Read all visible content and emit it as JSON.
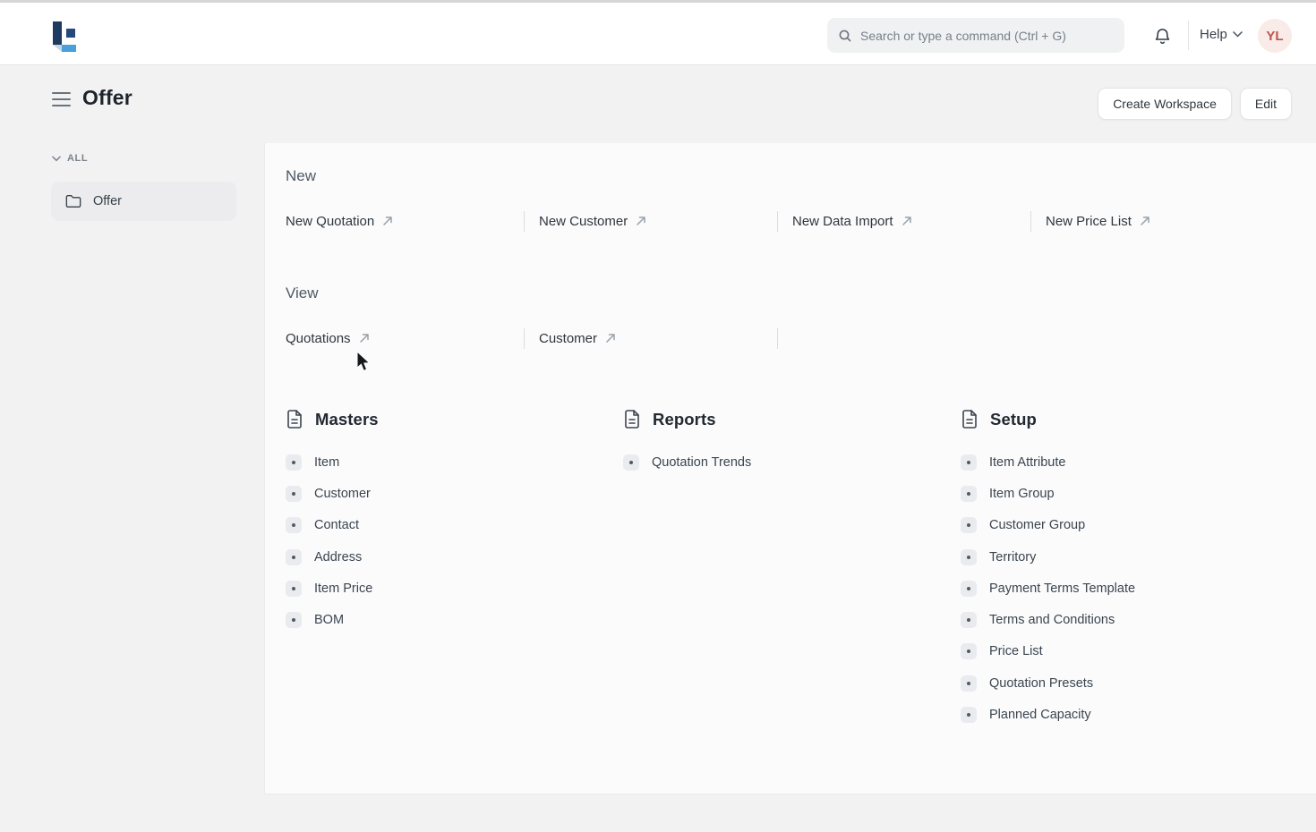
{
  "header": {
    "search_placeholder": "Search or type a command (Ctrl + G)",
    "help_label": "Help",
    "avatar_initials": "YL"
  },
  "page": {
    "title": "Offer",
    "create_workspace_label": "Create Workspace",
    "edit_label": "Edit"
  },
  "sidebar": {
    "group_label": "ALL",
    "items": [
      {
        "label": "Offer",
        "selected": true
      }
    ]
  },
  "sections": [
    {
      "title": "New",
      "links": [
        "New Quotation",
        "New Customer",
        "New Data Import",
        "New Price List"
      ]
    },
    {
      "title": "View",
      "links": [
        "Quotations",
        "Customer"
      ]
    }
  ],
  "cards": [
    {
      "title": "Masters",
      "items": [
        "Item",
        "Customer",
        "Contact",
        "Address",
        "Item Price",
        "BOM"
      ]
    },
    {
      "title": "Reports",
      "items": [
        "Quotation Trends"
      ]
    },
    {
      "title": "Setup",
      "items": [
        "Item Attribute",
        "Item Group",
        "Customer Group",
        "Territory",
        "Payment Terms Template",
        "Terms and Conditions",
        "Price List",
        "Quotation Presets",
        "Planned Capacity"
      ]
    }
  ],
  "colors": {
    "logo_dark": "#1e3a5e",
    "logo_mid": "#26497b",
    "logo_light": "#4aa0d9",
    "avatar_bg": "#f9ebe8",
    "avatar_text": "#c0554d"
  }
}
